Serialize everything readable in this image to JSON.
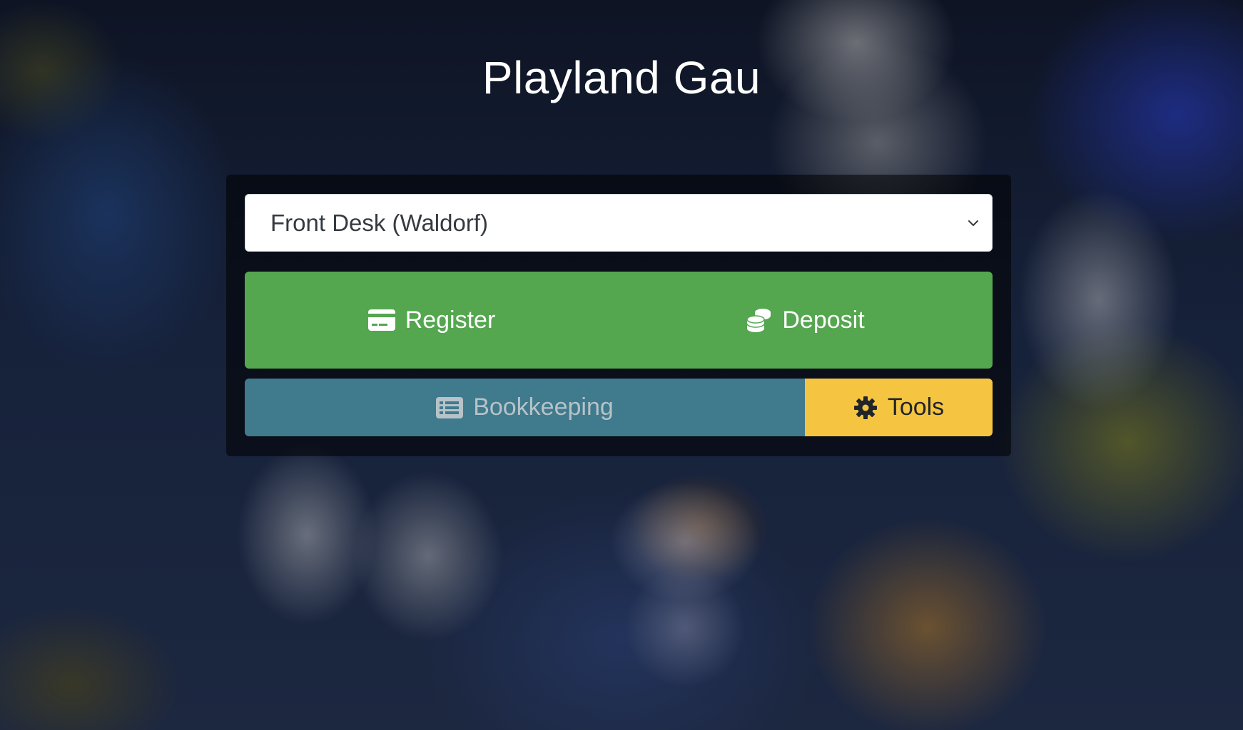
{
  "app": {
    "title": "Playland Gau"
  },
  "location_select": {
    "selected": "Front Desk (Waldorf)"
  },
  "actions": {
    "register_label": "Register",
    "deposit_label": "Deposit",
    "bookkeeping_label": "Bookkeeping",
    "tools_label": "Tools"
  },
  "icons": {
    "register": "credit-card-icon",
    "deposit": "coins-icon",
    "bookkeeping": "list-alt-icon",
    "tools": "gear-icon",
    "select": "chevron-down-icon"
  },
  "colors": {
    "primary_green": "#54a64f",
    "bookkeeping_teal": "#3f7a8d",
    "tools_yellow": "#f5c542"
  }
}
